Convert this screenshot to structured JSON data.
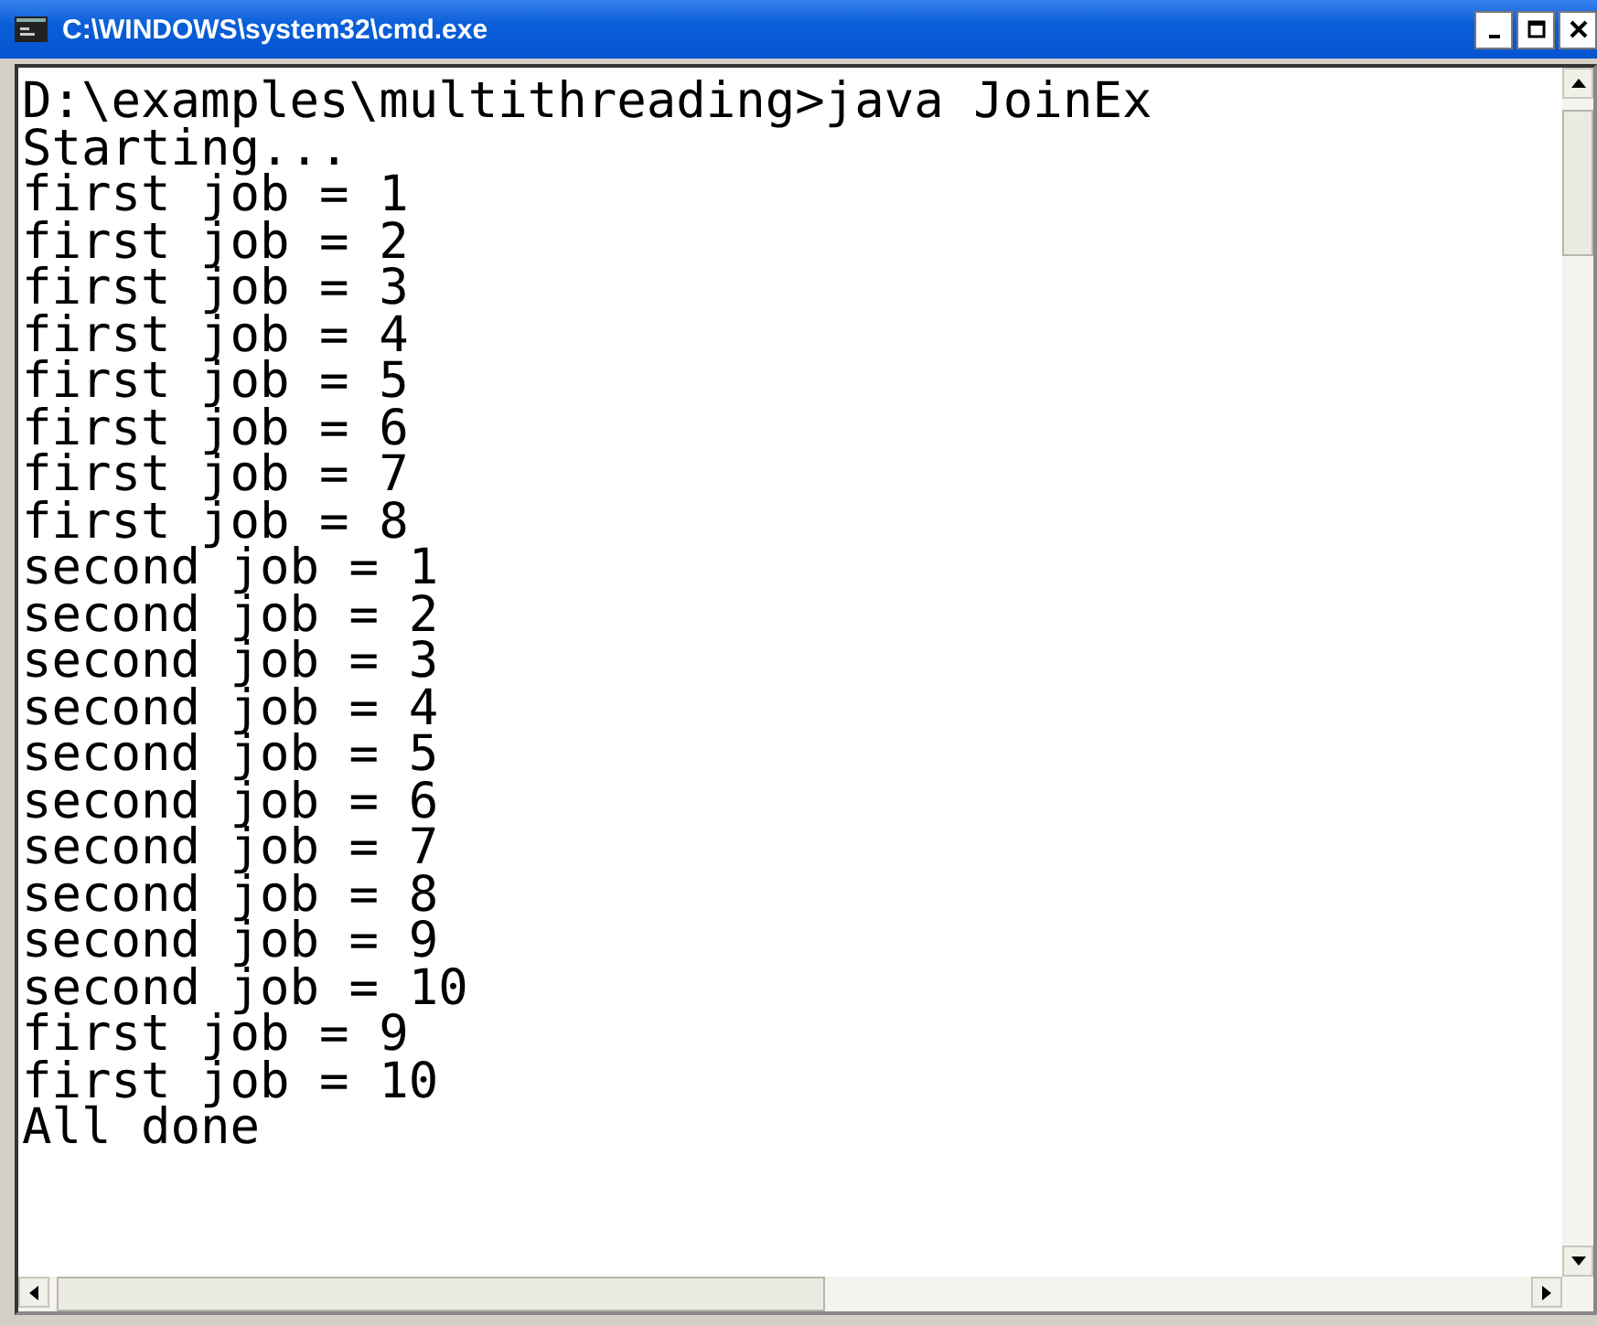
{
  "window": {
    "title": "C:\\WINDOWS\\system32\\cmd.exe"
  },
  "console": {
    "lines": [
      "D:\\examples\\multithreading>java JoinEx",
      "Starting...",
      "first job = 1",
      "first job = 2",
      "first job = 3",
      "first job = 4",
      "first job = 5",
      "first job = 6",
      "first job = 7",
      "first job = 8",
      "second job = 1",
      "second job = 2",
      "second job = 3",
      "second job = 4",
      "second job = 5",
      "second job = 6",
      "second job = 7",
      "second job = 8",
      "second job = 9",
      "second job = 10",
      "first job = 9",
      "first job = 10",
      "All done"
    ]
  }
}
